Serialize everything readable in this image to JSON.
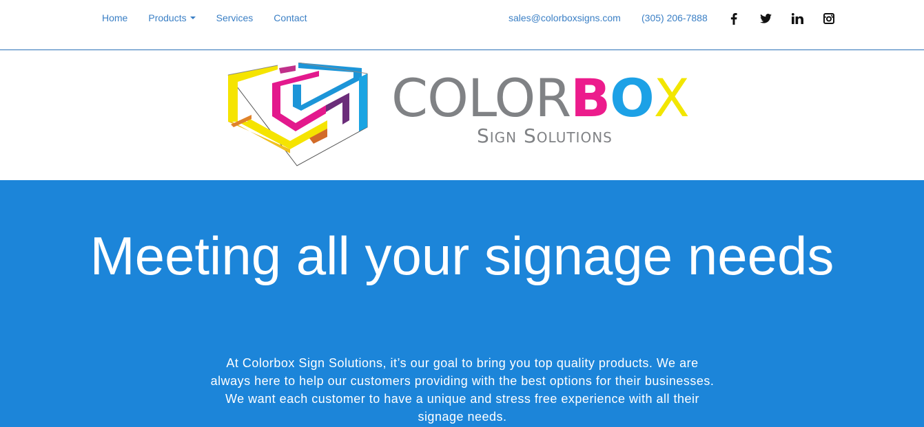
{
  "nav": {
    "home": "Home",
    "products": "Products",
    "services": "Services",
    "contact": "Contact",
    "email": "sales@colorboxsigns.com",
    "phone": "(305) 206-7888",
    "social": [
      "facebook-icon",
      "twitter-icon",
      "linkedin-icon",
      "instagram-icon"
    ]
  },
  "brand": {
    "word_gray": "COLOR",
    "word_b": "B",
    "word_o": "O",
    "word_x": "X",
    "tagline": "Sign Solutions",
    "colors": {
      "gray": "#808285",
      "magenta": "#ec1c8c",
      "cyan": "#1da1e6",
      "yellow": "#f2e600"
    }
  },
  "hero": {
    "title": "Meeting all your signage needs",
    "text": "At Colorbox Sign Solutions, it’s our goal to bring you top quality products. We are always here to help our customers providing with the best options for their businesses. We want each customer to have a unique and stress free experience with all their signage needs.",
    "background": "#1c85d9"
  }
}
